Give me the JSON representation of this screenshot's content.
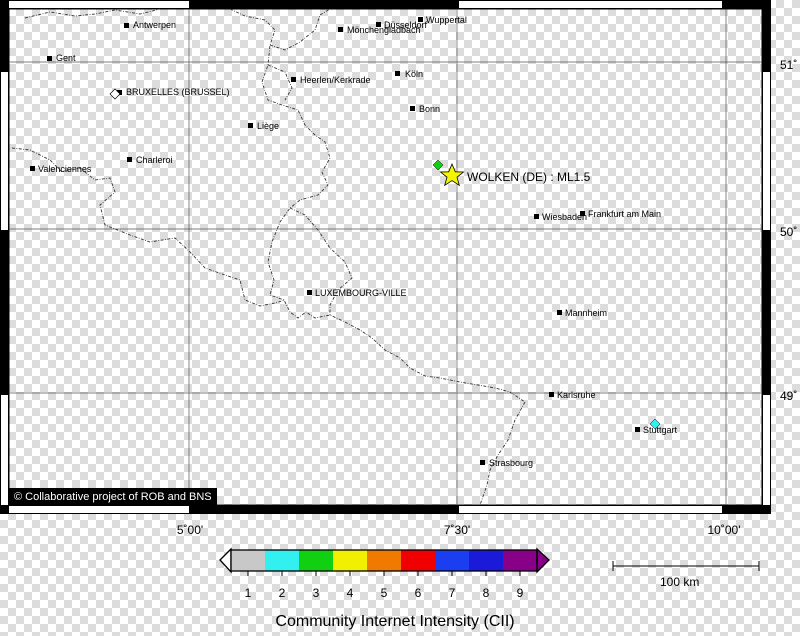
{
  "credit": "© Collaborative project of ROB and BNS",
  "event": {
    "label": "WOLKEN (DE) : ML1.5"
  },
  "cities": [
    {
      "name": "Antwerpen"
    },
    {
      "name": "Gent"
    },
    {
      "name": "BRUXELLES (BRUSSEL)"
    },
    {
      "name": "Düsseldorf"
    },
    {
      "name": "Mönchengladbach"
    },
    {
      "name": "Wuppertal"
    },
    {
      "name": "Heerlen/Kerkrade"
    },
    {
      "name": "Köln"
    },
    {
      "name": "Bonn"
    },
    {
      "name": "Liège"
    },
    {
      "name": "Charleroi"
    },
    {
      "name": "Valenciennes"
    },
    {
      "name": "Wiesbaden"
    },
    {
      "name": "Frankfurt am Main"
    },
    {
      "name": "LUXEMBOURG-VILLE"
    },
    {
      "name": "Mannheim"
    },
    {
      "name": "Karlsruhe"
    },
    {
      "name": "Stuttgart"
    },
    {
      "name": "Strasbourg"
    }
  ],
  "axes": {
    "lon_ticks": [
      "5˚00'",
      "7˚30'",
      "10˚00'"
    ],
    "lat_ticks": [
      "51˚",
      "50˚",
      "49˚"
    ]
  },
  "scale_bar": {
    "label": "100 km"
  },
  "legend": {
    "title": "Community Internet Intensity (CII)",
    "levels": [
      "1",
      "2",
      "3",
      "4",
      "5",
      "6",
      "7",
      "8",
      "9"
    ],
    "colors": {
      "1": "#c8c8c8",
      "2": "#33f0f0",
      "3": "#11d011",
      "4": "#f0f000",
      "5": "#f07a00",
      "6": "#f00000",
      "7": "#1a3ef0",
      "8": "#1a1ad8",
      "9": "#880088"
    }
  },
  "markers": [
    {
      "name": "green-report-marker",
      "level": "3"
    },
    {
      "name": "cyan-report-marker",
      "level": "2"
    },
    {
      "name": "white-report-marker",
      "level": "1"
    }
  ]
}
